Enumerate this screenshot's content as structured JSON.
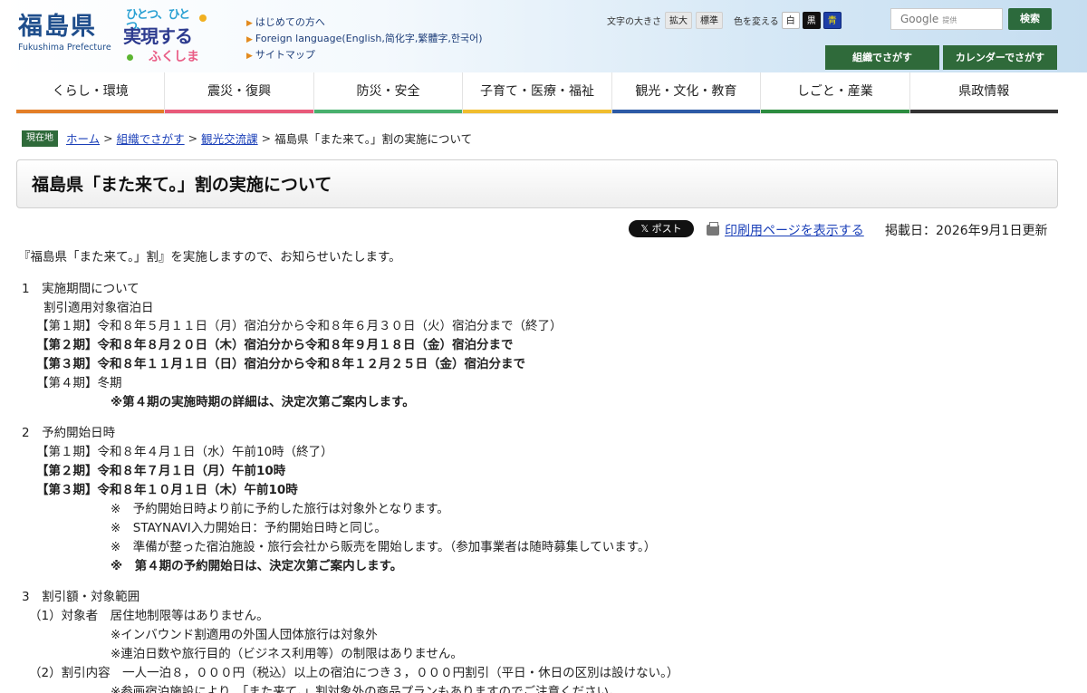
{
  "header": {
    "logo_jp": "福島県",
    "logo_en": "Fukushima Prefecture",
    "slogan": [
      "ひとつ、ひとつ、",
      "実現する",
      "ふくしま"
    ],
    "links": [
      "はじめての方へ",
      "Foreign language(English,简化字,繁體字,한국어)",
      "サイトマップ"
    ],
    "font_size_label": "文字の大きさ",
    "font_enlarge": "拡大",
    "font_standard": "標準",
    "color_label": "色を変える",
    "color_white": "白",
    "color_black": "黒",
    "color_blue": "青",
    "search_placeholder": "Google",
    "search_provided": "提供",
    "search_button": "検索",
    "org_button": "組織でさがす",
    "calendar_button": "カレンダーでさがす"
  },
  "nav": [
    {
      "label": "くらし・環境",
      "color": "#e37e27"
    },
    {
      "label": "震災・復興",
      "color": "#e85a7a"
    },
    {
      "label": "防災・安全",
      "color": "#48b06d"
    },
    {
      "label": "子育て・医療・福祉",
      "color": "#f0bd2e"
    },
    {
      "label": "観光・文化・教育",
      "color": "#2d5aa6"
    },
    {
      "label": "しごと・産業",
      "color": "#2c8c3f"
    },
    {
      "label": "県政情報",
      "color": "#333333"
    }
  ],
  "breadcrumb": {
    "tag": "現在地",
    "items": [
      "ホーム",
      "組織でさがす",
      "観光交流課"
    ],
    "current": "福島県「また来て。」割の実施について"
  },
  "page_title": "福島県「また来て。」割の実施について",
  "meta": {
    "xpost": "𝕏 ポスト",
    "print": "印刷用ページを表示する",
    "date": "掲載日：2026年9月1日更新"
  },
  "content": {
    "intro": "『福島県「また来て。」割』を実施しますので、お知らせいたします。",
    "s1_heading": "1　実施期間について",
    "s1_sub": "割引適用対象宿泊日",
    "s1_p1": "【第１期】令和８年５月１１日（月）宿泊分から令和８年６月３０日（火）宿泊分まで（終了）",
    "s1_p2": "【第２期】令和８年８月２０日（木）宿泊分から令和８年９月１８日（金）宿泊分まで",
    "s1_p3": "【第３期】令和８年１１月１日（日）宿泊分から令和８年１２月２５日（金）宿泊分まで",
    "s1_p4": "【第４期】冬期",
    "s1_note": "※第４期の実施時期の詳細は、決定次第ご案内します。",
    "s2_heading": "2　予約開始日時",
    "s2_p1": "【第１期】令和８年４月１日（水）午前10時（終了）",
    "s2_p2": "【第２期】令和８年７月１日（月）午前10時",
    "s2_p3": "【第３期】令和８年１０月１日（木）午前10時",
    "s2_n1": "※　予約開始日時より前に予約した旅行は対象外となります。",
    "s2_n2": "※　STAYNAVI入力開始日：予約開始日時と同じ。",
    "s2_n3": "※　準備が整った宿泊施設・旅行会社から販売を開始します。（参加事業者は随時募集しています。）",
    "s2_n4": "※　第４期の予約開始日は、決定次第ご案内します。",
    "s3_heading": "3　割引額・対象範囲",
    "s3_target": "（1）対象者　居住地制限等はありません。",
    "s3_t1": "※インバウンド割適用の外国人団体旅行は対象外",
    "s3_t2": "※連泊日数や旅行目的（ビジネス利用等）の制限はありません。",
    "s3_discount": "（2）割引内容　一人一泊８，０００円（税込）以上の宿泊につき３，０００円割引（平日・休日の区別は設けない。）",
    "s3_d1": "※参画宿泊施設により、「また来て。」割対象外の商品プランもありますのでご注意ください。"
  }
}
